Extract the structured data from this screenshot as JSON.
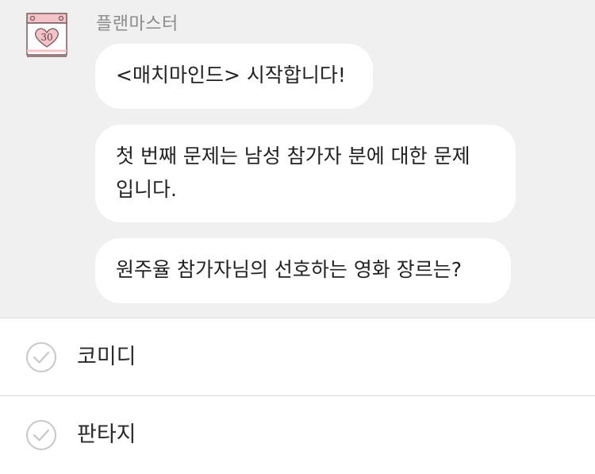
{
  "sender": {
    "name": "플랜마스터",
    "avatar_icon": "calendar-heart-icon",
    "avatar_number": "30"
  },
  "messages": [
    {
      "text": "<매치마인드> 시작합니다!"
    },
    {
      "text": "첫 번째 문제는 남성 참가자 분에 대한 문제\n입니다."
    },
    {
      "text": "원주율 참가자님의 선호하는 영화 장르는?"
    }
  ],
  "options": [
    {
      "label": "코미디",
      "icon": "check-circle-icon"
    },
    {
      "label": "판타지",
      "icon": "check-circle-icon"
    }
  ],
  "colors": {
    "chat_background": "#f0f0f0",
    "bubble": "#ffffff",
    "avatar_pink": "#f4c2c9",
    "avatar_stroke": "#7a5a5e",
    "check_gray": "#c8c8c8"
  }
}
